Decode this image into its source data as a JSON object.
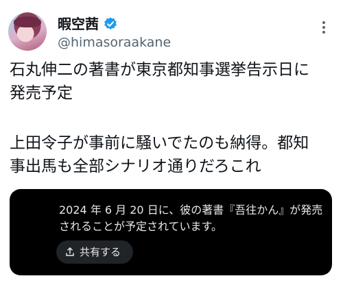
{
  "author": {
    "display_name": "暇空茜",
    "handle": "@himasoraakane",
    "verified": true
  },
  "tweet": {
    "lines": [
      "石丸伸二の著書が東京都知事選挙告示日に",
      "発売予定",
      "上田令子が事前に騒いでたのも納得。都知",
      "事出馬も全部シナリオ通りだろこれ"
    ]
  },
  "card": {
    "lines": [
      "2024 年 6 月 20 日に、彼の著書『吾往かん』が発売",
      "されることが予定されています。"
    ],
    "share_label": "共有する"
  },
  "colors": {
    "verified_badge": "#1d9bf0",
    "card_background": "#000000",
    "secondary_text": "#536471"
  },
  "icons": {
    "more": "more-options-icon",
    "verified": "verified-badge-icon",
    "share": "share-upload-icon"
  }
}
